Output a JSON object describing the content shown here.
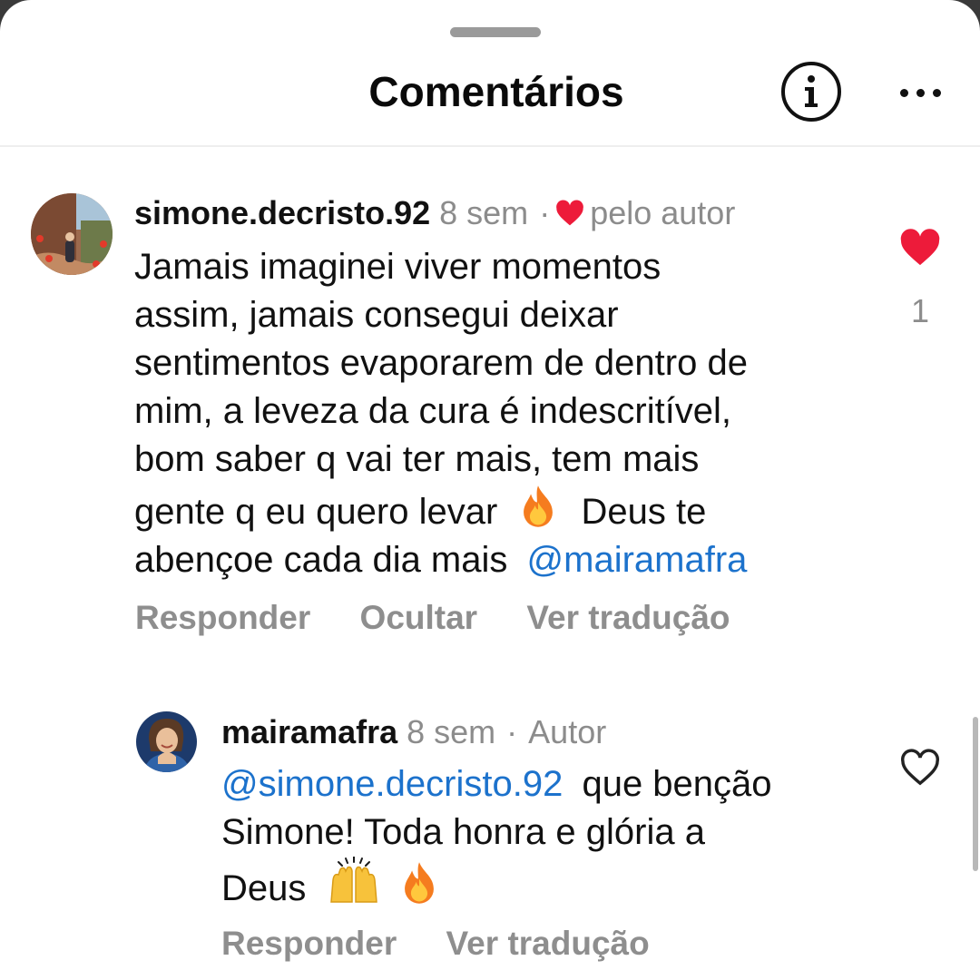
{
  "header": {
    "title": "Comentários"
  },
  "comments": [
    {
      "username": "simone.decristo.92",
      "time": "8 sem",
      "separator": "·",
      "author_liked_label": "pelo autor",
      "lines": [
        "Jamais imaginei viver momentos",
        "assim, jamais consegui deixar",
        "sentimentos evaporarem de dentro de",
        "mim, a leveza da cura é indescritível,",
        "bom saber q vai ter mais, tem mais",
        "gente q eu quero levar",
        "Deus te",
        "abençoe cada dia mais",
        "@mairamafra"
      ],
      "like_count": "1",
      "liked": true,
      "actions": [
        "Responder",
        "Ocultar",
        "Ver tradução"
      ]
    },
    {
      "username": "mairamafra",
      "time": "8 sem",
      "separator": "·",
      "role": "Autor",
      "mention": "@simone.decristo.92",
      "lines": [
        "que benção",
        "Simone! Toda honra e glória a",
        "Deus"
      ],
      "liked": false,
      "actions": [
        "Responder",
        "Ver tradução"
      ]
    }
  ],
  "icons": {
    "heart_filled": "heart-icon",
    "heart_outline": "heart-outline-icon",
    "fire": "fire-emoji-icon",
    "raised_hands": "raised-hands-emoji-icon"
  },
  "colors": {
    "mention": "#1c72cc",
    "heart": "#ed1b3a",
    "muted": "#8e8e8e"
  }
}
